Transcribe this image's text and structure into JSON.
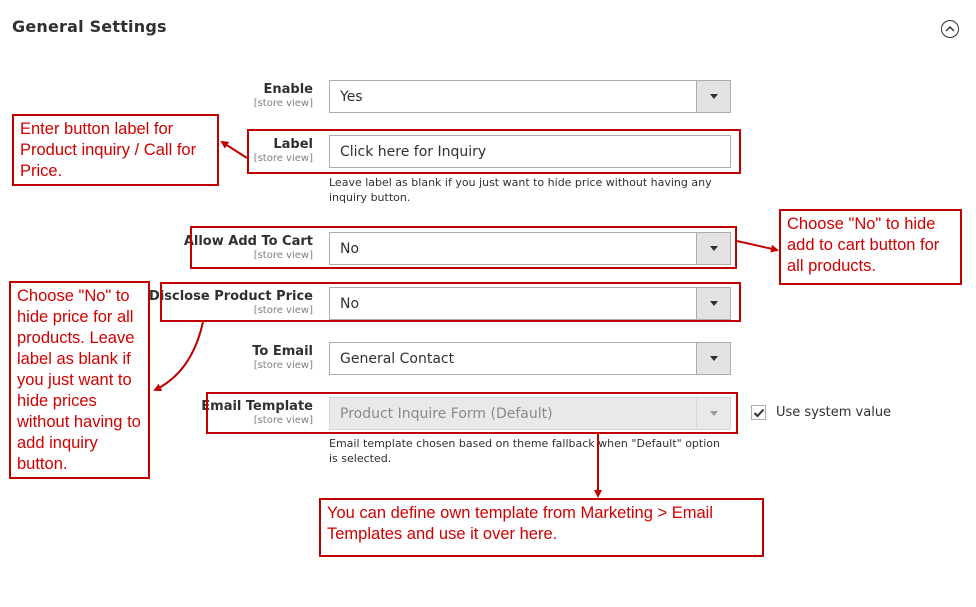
{
  "section": {
    "title": "General Settings",
    "collapse_icon": "chevron-up-icon"
  },
  "scope_text": "[store view]",
  "fields": {
    "enable": {
      "label": "Enable",
      "value": "Yes"
    },
    "label": {
      "label": "Label",
      "value": "Click here for Inquiry",
      "note": "Leave label as blank if you just want to hide price without having any inquiry button."
    },
    "allow_add_to_cart": {
      "label": "Allow Add To Cart",
      "value": "No"
    },
    "disclose_price": {
      "label": "Disclose Product Price",
      "value": "No"
    },
    "to_email": {
      "label": "To Email",
      "value": "General Contact"
    },
    "email_template": {
      "label": "Email Template",
      "value": "Product Inquire Form (Default)",
      "note": "Email template chosen based on theme fallback when \"Default\" option is selected.",
      "use_system_value_label": "Use system value",
      "use_system_value_checked": true
    }
  },
  "callouts": {
    "label_tip": "Enter button label for Product inquiry / Call for Price.",
    "cart_tip": "Choose \"No\" to hide add to cart button for all products.",
    "price_tip": "Choose \"No\" to hide price for all products. Leave label as blank if you just want to hide prices without having to add inquiry button.",
    "template_tip": "You can define own template from Marketing > Email Templates and use it over here."
  },
  "colors": {
    "annotation_red": "#c00000"
  }
}
